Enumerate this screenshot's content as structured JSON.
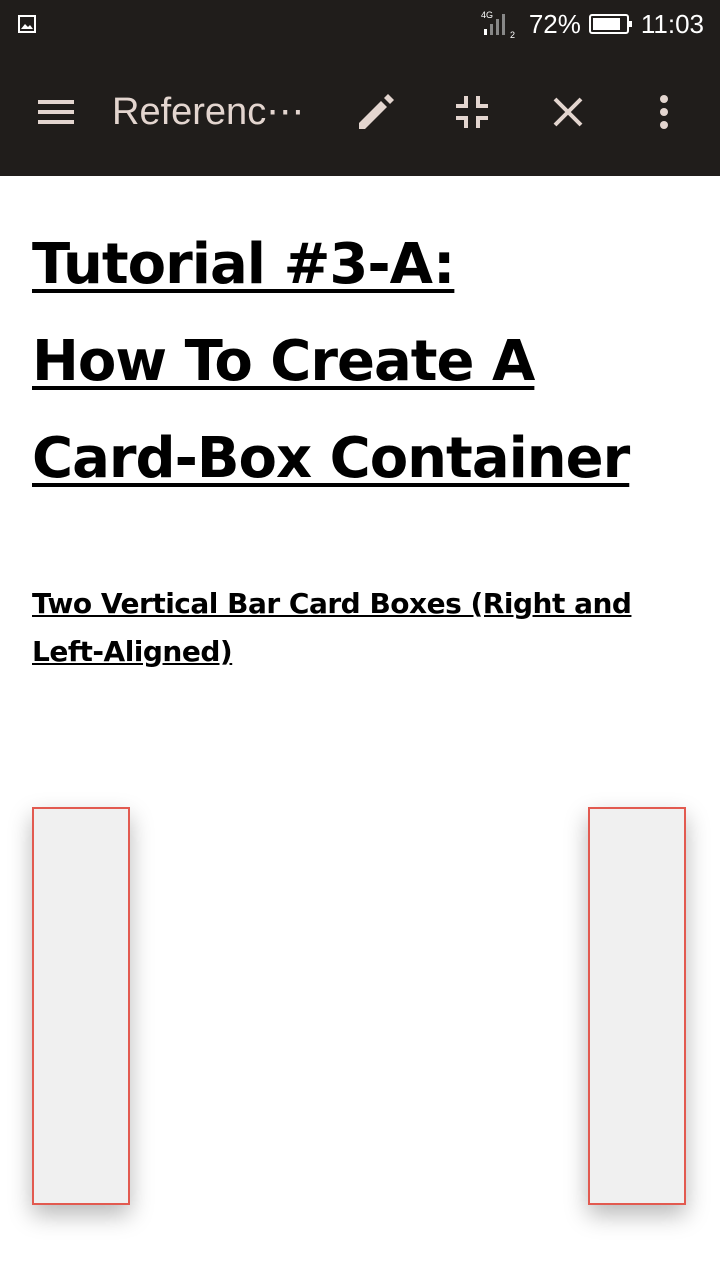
{
  "status_bar": {
    "network": "4G",
    "sim": "2",
    "battery": "72%",
    "time": "11:03"
  },
  "toolbar": {
    "title": "Referenc⋯",
    "icons": [
      "menu-icon",
      "edit-icon",
      "collapse-icon",
      "close-icon",
      "more-vert-icon"
    ]
  },
  "content": {
    "title_lines": [
      "Tutorial #3-A:",
      "How To Create A",
      "Card-Box Container"
    ],
    "subtitle": "Two Vertical Bar Card Boxes (Right and Left-Aligned)"
  },
  "colors": {
    "toolbar_bg": "#201d1b",
    "toolbar_icon": "#e3d5cf",
    "card_border": "#e25a50",
    "card_fill": "#f0f0f0"
  }
}
